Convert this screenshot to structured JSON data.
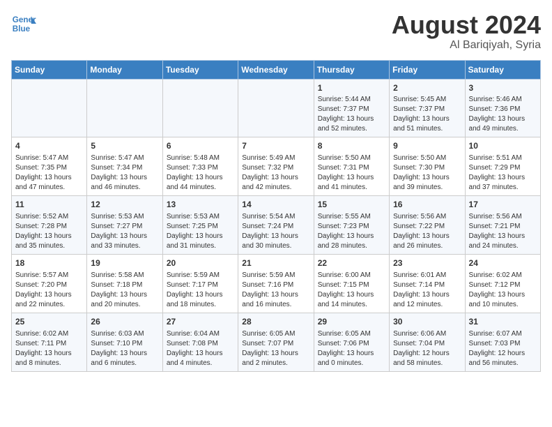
{
  "header": {
    "logo_line1": "General",
    "logo_line2": "Blue",
    "main_title": "August 2024",
    "sub_title": "Al Bariqiyah, Syria"
  },
  "weekdays": [
    "Sunday",
    "Monday",
    "Tuesday",
    "Wednesday",
    "Thursday",
    "Friday",
    "Saturday"
  ],
  "weeks": [
    [
      {
        "day": "",
        "info": ""
      },
      {
        "day": "",
        "info": ""
      },
      {
        "day": "",
        "info": ""
      },
      {
        "day": "",
        "info": ""
      },
      {
        "day": "1",
        "info": "Sunrise: 5:44 AM\nSunset: 7:37 PM\nDaylight: 13 hours\nand 52 minutes."
      },
      {
        "day": "2",
        "info": "Sunrise: 5:45 AM\nSunset: 7:37 PM\nDaylight: 13 hours\nand 51 minutes."
      },
      {
        "day": "3",
        "info": "Sunrise: 5:46 AM\nSunset: 7:36 PM\nDaylight: 13 hours\nand 49 minutes."
      }
    ],
    [
      {
        "day": "4",
        "info": "Sunrise: 5:47 AM\nSunset: 7:35 PM\nDaylight: 13 hours\nand 47 minutes."
      },
      {
        "day": "5",
        "info": "Sunrise: 5:47 AM\nSunset: 7:34 PM\nDaylight: 13 hours\nand 46 minutes."
      },
      {
        "day": "6",
        "info": "Sunrise: 5:48 AM\nSunset: 7:33 PM\nDaylight: 13 hours\nand 44 minutes."
      },
      {
        "day": "7",
        "info": "Sunrise: 5:49 AM\nSunset: 7:32 PM\nDaylight: 13 hours\nand 42 minutes."
      },
      {
        "day": "8",
        "info": "Sunrise: 5:50 AM\nSunset: 7:31 PM\nDaylight: 13 hours\nand 41 minutes."
      },
      {
        "day": "9",
        "info": "Sunrise: 5:50 AM\nSunset: 7:30 PM\nDaylight: 13 hours\nand 39 minutes."
      },
      {
        "day": "10",
        "info": "Sunrise: 5:51 AM\nSunset: 7:29 PM\nDaylight: 13 hours\nand 37 minutes."
      }
    ],
    [
      {
        "day": "11",
        "info": "Sunrise: 5:52 AM\nSunset: 7:28 PM\nDaylight: 13 hours\nand 35 minutes."
      },
      {
        "day": "12",
        "info": "Sunrise: 5:53 AM\nSunset: 7:27 PM\nDaylight: 13 hours\nand 33 minutes."
      },
      {
        "day": "13",
        "info": "Sunrise: 5:53 AM\nSunset: 7:25 PM\nDaylight: 13 hours\nand 31 minutes."
      },
      {
        "day": "14",
        "info": "Sunrise: 5:54 AM\nSunset: 7:24 PM\nDaylight: 13 hours\nand 30 minutes."
      },
      {
        "day": "15",
        "info": "Sunrise: 5:55 AM\nSunset: 7:23 PM\nDaylight: 13 hours\nand 28 minutes."
      },
      {
        "day": "16",
        "info": "Sunrise: 5:56 AM\nSunset: 7:22 PM\nDaylight: 13 hours\nand 26 minutes."
      },
      {
        "day": "17",
        "info": "Sunrise: 5:56 AM\nSunset: 7:21 PM\nDaylight: 13 hours\nand 24 minutes."
      }
    ],
    [
      {
        "day": "18",
        "info": "Sunrise: 5:57 AM\nSunset: 7:20 PM\nDaylight: 13 hours\nand 22 minutes."
      },
      {
        "day": "19",
        "info": "Sunrise: 5:58 AM\nSunset: 7:18 PM\nDaylight: 13 hours\nand 20 minutes."
      },
      {
        "day": "20",
        "info": "Sunrise: 5:59 AM\nSunset: 7:17 PM\nDaylight: 13 hours\nand 18 minutes."
      },
      {
        "day": "21",
        "info": "Sunrise: 5:59 AM\nSunset: 7:16 PM\nDaylight: 13 hours\nand 16 minutes."
      },
      {
        "day": "22",
        "info": "Sunrise: 6:00 AM\nSunset: 7:15 PM\nDaylight: 13 hours\nand 14 minutes."
      },
      {
        "day": "23",
        "info": "Sunrise: 6:01 AM\nSunset: 7:14 PM\nDaylight: 13 hours\nand 12 minutes."
      },
      {
        "day": "24",
        "info": "Sunrise: 6:02 AM\nSunset: 7:12 PM\nDaylight: 13 hours\nand 10 minutes."
      }
    ],
    [
      {
        "day": "25",
        "info": "Sunrise: 6:02 AM\nSunset: 7:11 PM\nDaylight: 13 hours\nand 8 minutes."
      },
      {
        "day": "26",
        "info": "Sunrise: 6:03 AM\nSunset: 7:10 PM\nDaylight: 13 hours\nand 6 minutes."
      },
      {
        "day": "27",
        "info": "Sunrise: 6:04 AM\nSunset: 7:08 PM\nDaylight: 13 hours\nand 4 minutes."
      },
      {
        "day": "28",
        "info": "Sunrise: 6:05 AM\nSunset: 7:07 PM\nDaylight: 13 hours\nand 2 minutes."
      },
      {
        "day": "29",
        "info": "Sunrise: 6:05 AM\nSunset: 7:06 PM\nDaylight: 13 hours\nand 0 minutes."
      },
      {
        "day": "30",
        "info": "Sunrise: 6:06 AM\nSunset: 7:04 PM\nDaylight: 12 hours\nand 58 minutes."
      },
      {
        "day": "31",
        "info": "Sunrise: 6:07 AM\nSunset: 7:03 PM\nDaylight: 12 hours\nand 56 minutes."
      }
    ]
  ]
}
